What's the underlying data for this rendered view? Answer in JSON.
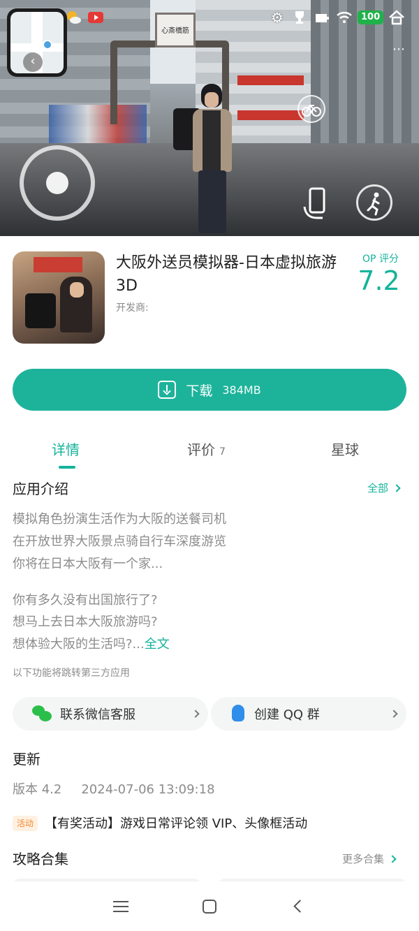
{
  "hero": {
    "sign_text": "心斎橋筋",
    "battery_level": "100",
    "icons": [
      "minimap",
      "weather-icon",
      "youtube-icon",
      "settings-icon",
      "trophy-icon",
      "signal-icon",
      "wifi-icon",
      "battery-icon",
      "home-icon",
      "more-icon",
      "joystick",
      "bike-icon",
      "phone-icon",
      "sprint-icon"
    ]
  },
  "app": {
    "title": "大阪外送员模拟器-日本虚拟旅游 3D",
    "developer_label": "开发商:",
    "op_label": "OP 评分",
    "op_score": "7.2"
  },
  "download": {
    "label": "下载",
    "size": "384MB"
  },
  "tabs": [
    {
      "label": "详情",
      "count": ""
    },
    {
      "label": "评价",
      "count": "7"
    },
    {
      "label": "星球",
      "count": ""
    }
  ],
  "intro": {
    "title": "应用介绍",
    "all_link": "全部",
    "lines": [
      "模拟角色扮演生活作为大阪的送餐司机",
      "在开放世界大阪景点骑自行车深度游览",
      "你将在日本大阪有一个家...",
      "你有多久没有出国旅行了?",
      "想马上去日本大阪旅游吗?",
      "想体验大阪的生活吗?..."
    ],
    "read_more": "全文",
    "notice": "以下功能将跳转第三方应用"
  },
  "contacts": {
    "wechat_label": "联系微信客服",
    "qq_label": "创建 QQ 群"
  },
  "update": {
    "title": "更新",
    "version": "版本 4.2",
    "date": "2024-07-06 13:09:18"
  },
  "event": {
    "badge": "活动",
    "text": "【有奖活动】游戏日常评论领 VIP、头像框活动"
  },
  "guides": {
    "title": "攻略合集",
    "more_link": "更多合集"
  },
  "colors": {
    "accent": "#1db39b",
    "wechat": "#2bbf4a",
    "qq": "#2e8ee9",
    "event": "#f08a2e"
  }
}
